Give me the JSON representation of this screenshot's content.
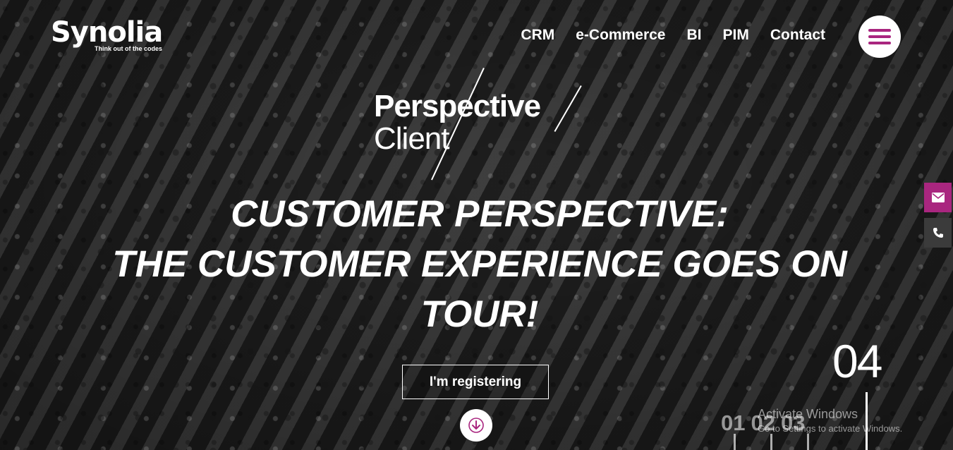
{
  "brand": {
    "name": "Synolia",
    "tagline": "Think out of the codes"
  },
  "nav": {
    "items": [
      "CRM",
      "e-Commerce",
      "BI",
      "PIM",
      "Contact"
    ]
  },
  "event_logo": {
    "line1": "Perspective",
    "line2": "Client"
  },
  "hero": {
    "headline_lines": [
      "CUSTOMER PERSPECTIVE:",
      "THE CUSTOMER EXPERIENCE GOES ON",
      "TOUR!"
    ],
    "cta_label": "I'm registering"
  },
  "slider": {
    "current": "04",
    "others": [
      "01",
      "02",
      "03"
    ]
  },
  "watermark": {
    "title": "Activate Windows",
    "subtitle": "Go to Settings to activate Windows."
  },
  "colors": {
    "accent": "#a9267f",
    "phone_button": "#3b3b3b"
  },
  "icons": {
    "menu": "hamburger-icon",
    "scroll": "arrow-down-icon",
    "mail": "envelope-icon",
    "phone": "phone-icon"
  }
}
